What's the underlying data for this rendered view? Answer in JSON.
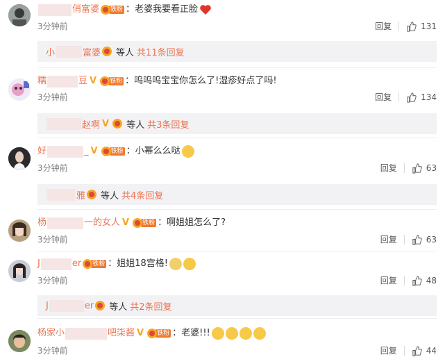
{
  "comments": [
    {
      "name_tail": "俏富婆",
      "text": "老婆我要看正脸",
      "time": "3分钟前",
      "reply": "回复",
      "likes": "131",
      "sub": {
        "user": "小",
        "user_tail": "富婆",
        "etc": "等人",
        "more": "共11条回复"
      }
    },
    {
      "name_head": "糯",
      "name_tail": "豆",
      "text": "呜呜呜宝宝你怎么了!湿疹好点了吗!",
      "time": "3分钟前",
      "reply": "回复",
      "likes": "134",
      "sub": {
        "user": "赵啊",
        "etc": "等人",
        "more": "共3条回复"
      }
    },
    {
      "name_head": "好",
      "name_tail": "_",
      "text": "小幂么么哒",
      "time": "3分钟前",
      "reply": "回复",
      "likes": "63",
      "sub": {
        "user": "雅",
        "etc": "等人",
        "more": "共4条回复"
      }
    },
    {
      "name_head": "杨",
      "name_tail": "一的女人",
      "text": "啊姐姐怎么了?",
      "time": "3分钟前",
      "reply": "回复",
      "likes": "63"
    },
    {
      "name_head": "J",
      "name_tail": "er",
      "text": "姐姐18宫格!",
      "time": "3分钟前",
      "reply": "回复",
      "likes": "48",
      "sub": {
        "user": "J",
        "user_tail": "er",
        "etc": "等人",
        "more": "共2条回复"
      }
    },
    {
      "name_head": "杨家小",
      "name_tail": "吧柒酱",
      "text": "老婆!!!",
      "time": "3分钟前",
      "reply": "回复",
      "likes": "44"
    }
  ],
  "colors": {
    "username": "#eb7350",
    "time": "#808080",
    "subbar_bg": "#f2f2f5"
  },
  "fan_badge_label": "铁粉"
}
